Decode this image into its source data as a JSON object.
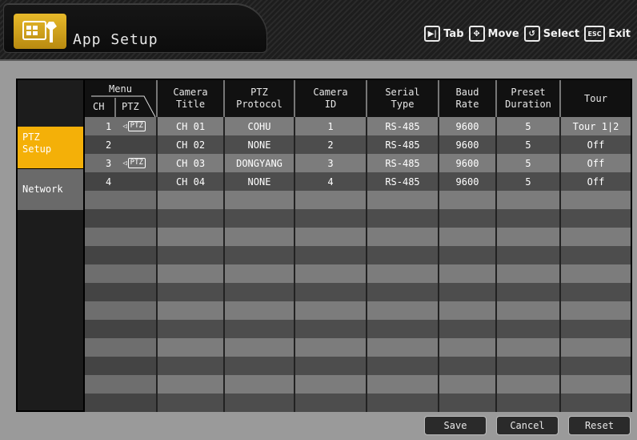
{
  "header": {
    "title": "App Setup",
    "hints": [
      {
        "icon": "tab-key-icon",
        "key": "▶|",
        "label": "Tab"
      },
      {
        "icon": "move-key-icon",
        "key": "✥",
        "label": "Move"
      },
      {
        "icon": "select-key-icon",
        "key": "↺",
        "label": "Select"
      },
      {
        "icon": "esc-key-icon",
        "key": "ESC",
        "label": "Exit"
      }
    ]
  },
  "sidebar": {
    "items": [
      {
        "label": "PTZ\nSetup",
        "active": true
      },
      {
        "label": "Network",
        "active": false
      }
    ]
  },
  "table": {
    "menu_header": {
      "title": "Menu",
      "ch": "CH",
      "ptz": "PTZ"
    },
    "columns": [
      "Camera\nTitle",
      "PTZ\nProtocol",
      "Camera\nID",
      "Serial\nType",
      "Baud\nRate",
      "Preset\nDuration",
      "Tour"
    ],
    "rows": [
      {
        "ch": "1",
        "ptz": true,
        "title": "CH 01",
        "protocol": "COHU",
        "id": "1",
        "serial": "RS-485",
        "baud": "9600",
        "preset": "5",
        "tour": "Tour 1|2"
      },
      {
        "ch": "2",
        "ptz": false,
        "title": "CH 02",
        "protocol": "NONE",
        "id": "2",
        "serial": "RS-485",
        "baud": "9600",
        "preset": "5",
        "tour": "Off"
      },
      {
        "ch": "3",
        "ptz": true,
        "title": "CH 03",
        "protocol": "DONGYANG",
        "id": "3",
        "serial": "RS-485",
        "baud": "9600",
        "preset": "5",
        "tour": "Off"
      },
      {
        "ch": "4",
        "ptz": false,
        "title": "CH 04",
        "protocol": "NONE",
        "id": "4",
        "serial": "RS-485",
        "baud": "9600",
        "preset": "5",
        "tour": "Off"
      }
    ],
    "ptz_badge": "PTZ",
    "empty_rows": 12
  },
  "buttons": {
    "save": "Save",
    "cancel": "Cancel",
    "reset": "Reset"
  },
  "colors": {
    "accent": "#f4b008",
    "row_light": "#7c7c7c",
    "row_dark": "#4d4d4d"
  }
}
